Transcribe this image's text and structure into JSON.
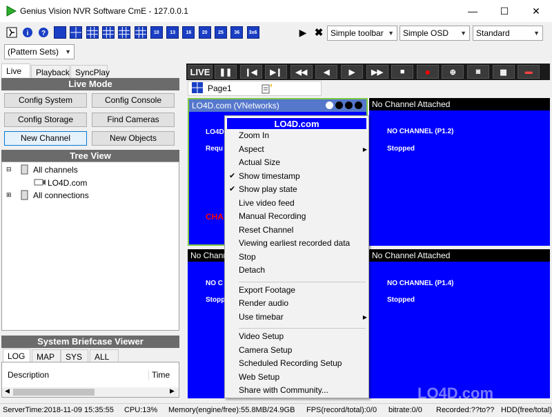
{
  "window": {
    "title": "Genius Vision NVR Software CmE - 127.0.0.1",
    "minimize": "—",
    "maximize": "☐",
    "close": "✕"
  },
  "toolbar": {
    "layout_labels": [
      "1",
      "4",
      "6",
      "7",
      "8",
      "9",
      "10",
      "13",
      "16",
      "20",
      "25",
      "36",
      "3x6"
    ],
    "play": "▶",
    "stop": "✖",
    "toolbar_mode": "Simple toolbar",
    "osd_mode": "Simple OSD",
    "profile": "Standard",
    "pattern_sets": "(Pattern Sets)"
  },
  "left": {
    "tabs": [
      "Live",
      "Playback",
      "SyncPlay"
    ],
    "live_mode_header": "Live Mode",
    "buttons": [
      "Config System",
      "Config Console",
      "Config Storage",
      "Find Cameras",
      "New Channel",
      "New Objects"
    ],
    "tree_view_header": "Tree View",
    "tree": {
      "all_channels": "All channels",
      "channel": "LO4D.com",
      "all_connections": "All connections"
    },
    "briefcase_header": "System Briefcase Viewer",
    "log_tabs": [
      "LOG",
      "MAP",
      "SYS",
      "ALL"
    ],
    "log_columns": [
      "Description",
      "Time"
    ]
  },
  "video": {
    "live_label": "LIVE",
    "page_tab": "Page1",
    "cells": [
      {
        "header": "LO4D.com (VNetworks)",
        "line1": "LO4D",
        "line2": "Requ",
        "line3": "CHA"
      },
      {
        "header": "No Channel Attached",
        "line1": "NO CHANNEL (P1.2)",
        "line2": "Stopped"
      },
      {
        "header": "No Chann",
        "line1": "NO C",
        "line2": "Stopp"
      },
      {
        "header": "No Channel Attached",
        "line1": "NO CHANNEL (P1.4)",
        "line2": "Stopped"
      }
    ]
  },
  "context_menu": {
    "title": "LO4D.com",
    "items": [
      {
        "label": "Zoom In"
      },
      {
        "label": "Aspect",
        "submenu": true
      },
      {
        "label": "Actual Size"
      },
      {
        "label": "Show timestamp",
        "checked": true
      },
      {
        "label": "Show play state",
        "checked": true
      },
      {
        "label": "Live video feed"
      },
      {
        "label": "Manual Recording"
      },
      {
        "label": "Reset Channel"
      },
      {
        "label": "Viewing earliest recorded data"
      },
      {
        "label": "Stop"
      },
      {
        "label": "Detach"
      },
      {
        "label": "Export Footage"
      },
      {
        "label": "Render audio"
      },
      {
        "label": "Use timebar",
        "submenu": true
      },
      {
        "label": "Video Setup"
      },
      {
        "label": "Camera Setup"
      },
      {
        "label": "Scheduled Recording Setup"
      },
      {
        "label": "Web Setup"
      },
      {
        "label": "Share with Community..."
      }
    ]
  },
  "status": {
    "server_time": "ServerTime:2018-11-09 15:35:55",
    "cpu": "CPU:13%",
    "memory": "Memory(engine/free):55.8MB/24.9GB",
    "fps": "FPS(record/total):0/0",
    "bitrate": "bitrate:0/0",
    "recorded": "Recorded:??to??",
    "hdd": "HDD(free/total):"
  },
  "watermark": "LO4D.com"
}
